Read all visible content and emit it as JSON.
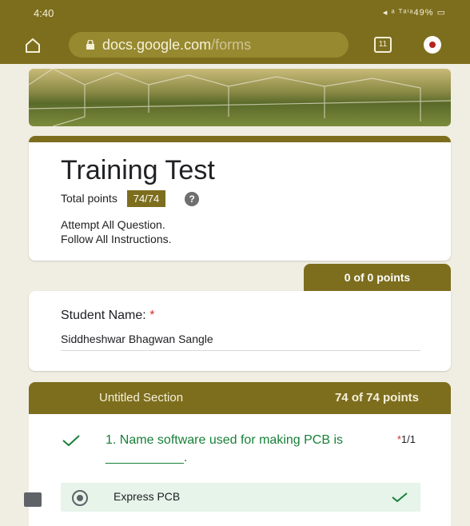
{
  "status_bar": {
    "time": "4:40",
    "icons_text": "◂ ᵃ ᵀᵃⁱᵃ49% ▭"
  },
  "browser": {
    "url_host": "docs.google.com",
    "url_path": "/forms",
    "tab_count": "11"
  },
  "form": {
    "title": "Training Test",
    "total_points_label": "Total points",
    "total_points_value": "74/74",
    "help": "?",
    "description_lines": [
      "Attempt All Question.",
      "Follow All Instructions."
    ]
  },
  "student_question": {
    "score": "0 of 0 points",
    "label": "Student Name:",
    "required_mark": "*",
    "answer": "Siddheshwar Bhagwan Sangle"
  },
  "section": {
    "title": "Untitled Section",
    "points": "74 of 74 points"
  },
  "question1": {
    "text": "1. Name software used for making PCB is ___________.",
    "required_mark": "*",
    "score": "1/1",
    "selected_option": "Express PCB"
  },
  "colors": {
    "theme": "#7d6e1e",
    "correct_green": "#188038",
    "correct_bg": "#e6f4ea"
  }
}
